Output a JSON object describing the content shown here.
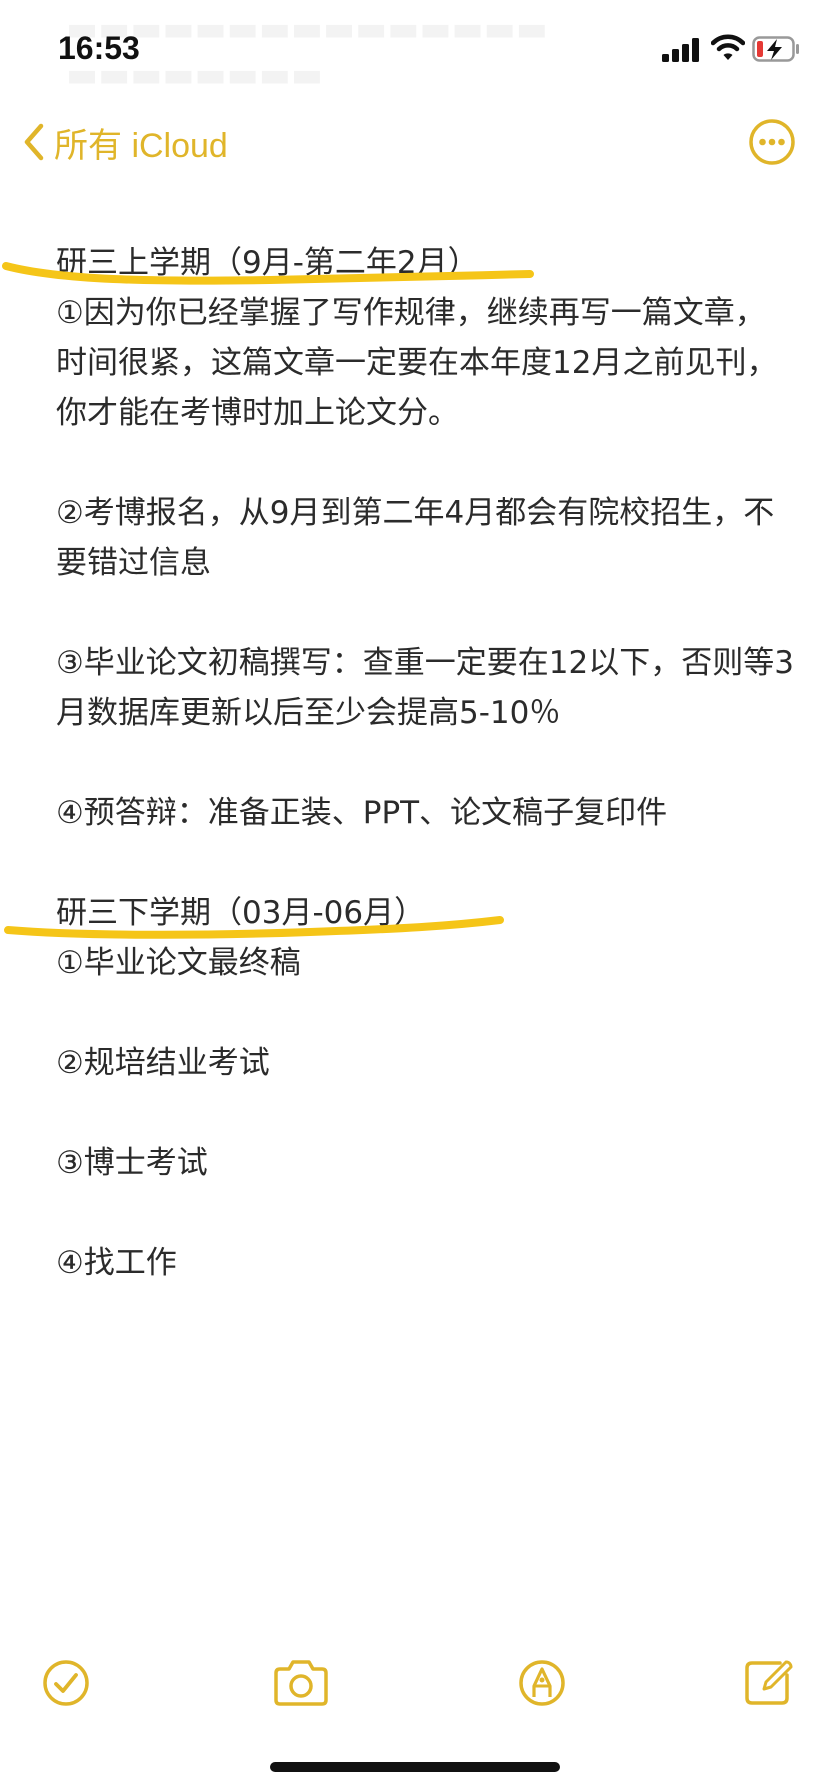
{
  "status_bar": {
    "time": "16:53",
    "icons": [
      "signal-icon",
      "wifi-icon",
      "battery-charging-icon"
    ]
  },
  "nav": {
    "back_label": "所有 iCloud",
    "back_icon": "chevron-left-icon",
    "more_icon": "more-circle-icon"
  },
  "colors": {
    "accent": "#e0b52a",
    "highlight": "#f5c518",
    "text": "#2b2b2b"
  },
  "note": {
    "section1": {
      "heading": "研三上学期（9月-第二年2月）",
      "items": [
        "①因为你已经掌握了写作规律，继续再写一篇文章，时间很紧，这篇文章一定要在本年度12月之前见刊，你才能在考博时加上论文分。",
        "②考博报名，从9月到第二年4月都会有院校招生，不要错过信息",
        "③毕业论文初稿撰写：查重一定要在12以下，否则等3月数据库更新以后至少会提高5-10％",
        "④预答辩：准备正装、PPT、论文稿子复印件"
      ]
    },
    "section2": {
      "heading": "研三下学期（03月-06月）",
      "items": [
        "①毕业论文最终稿",
        "②规培结业考试",
        "③博士考试",
        "④找工作"
      ]
    }
  },
  "toolbar": {
    "icons": [
      "checklist-icon",
      "camera-icon",
      "markup-pen-icon",
      "compose-icon"
    ]
  }
}
